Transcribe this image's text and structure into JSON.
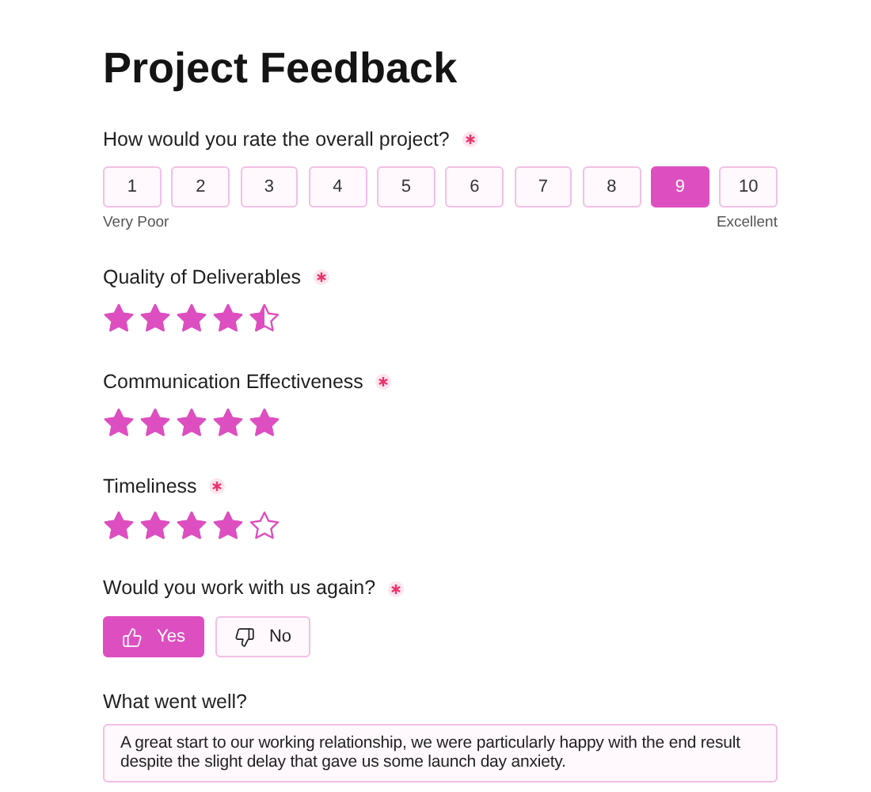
{
  "title": "Project Feedback",
  "scale_question": {
    "label": "How would you rate the overall project?",
    "required": true,
    "options": [
      {
        "label": "1",
        "selected": false
      },
      {
        "label": "2",
        "selected": false
      },
      {
        "label": "3",
        "selected": false
      },
      {
        "label": "4",
        "selected": false
      },
      {
        "label": "5",
        "selected": false
      },
      {
        "label": "6",
        "selected": false
      },
      {
        "label": "7",
        "selected": false
      },
      {
        "label": "8",
        "selected": false
      },
      {
        "label": "9",
        "selected": true
      },
      {
        "label": "10",
        "selected": false
      }
    ],
    "min_label": "Very Poor",
    "max_label": "Excellent"
  },
  "star_questions": [
    {
      "label": "Quality of Deliverables",
      "required": true,
      "stars": 4.5
    },
    {
      "label": "Communication Effectiveness",
      "required": true,
      "stars": 5
    },
    {
      "label": "Timeliness",
      "required": true,
      "stars": 4
    }
  ],
  "yes_no": {
    "label": "Would you work with us again?",
    "required": true,
    "options": [
      {
        "kind": "up",
        "label": "Yes",
        "selected": true
      },
      {
        "kind": "down",
        "label": "No",
        "selected": false
      }
    ]
  },
  "text_question": {
    "label": "What went well?",
    "value": "A great start to our working relationship, we were particularly happy with the end result despite the slight delay that gave us some launch day anxiety."
  }
}
